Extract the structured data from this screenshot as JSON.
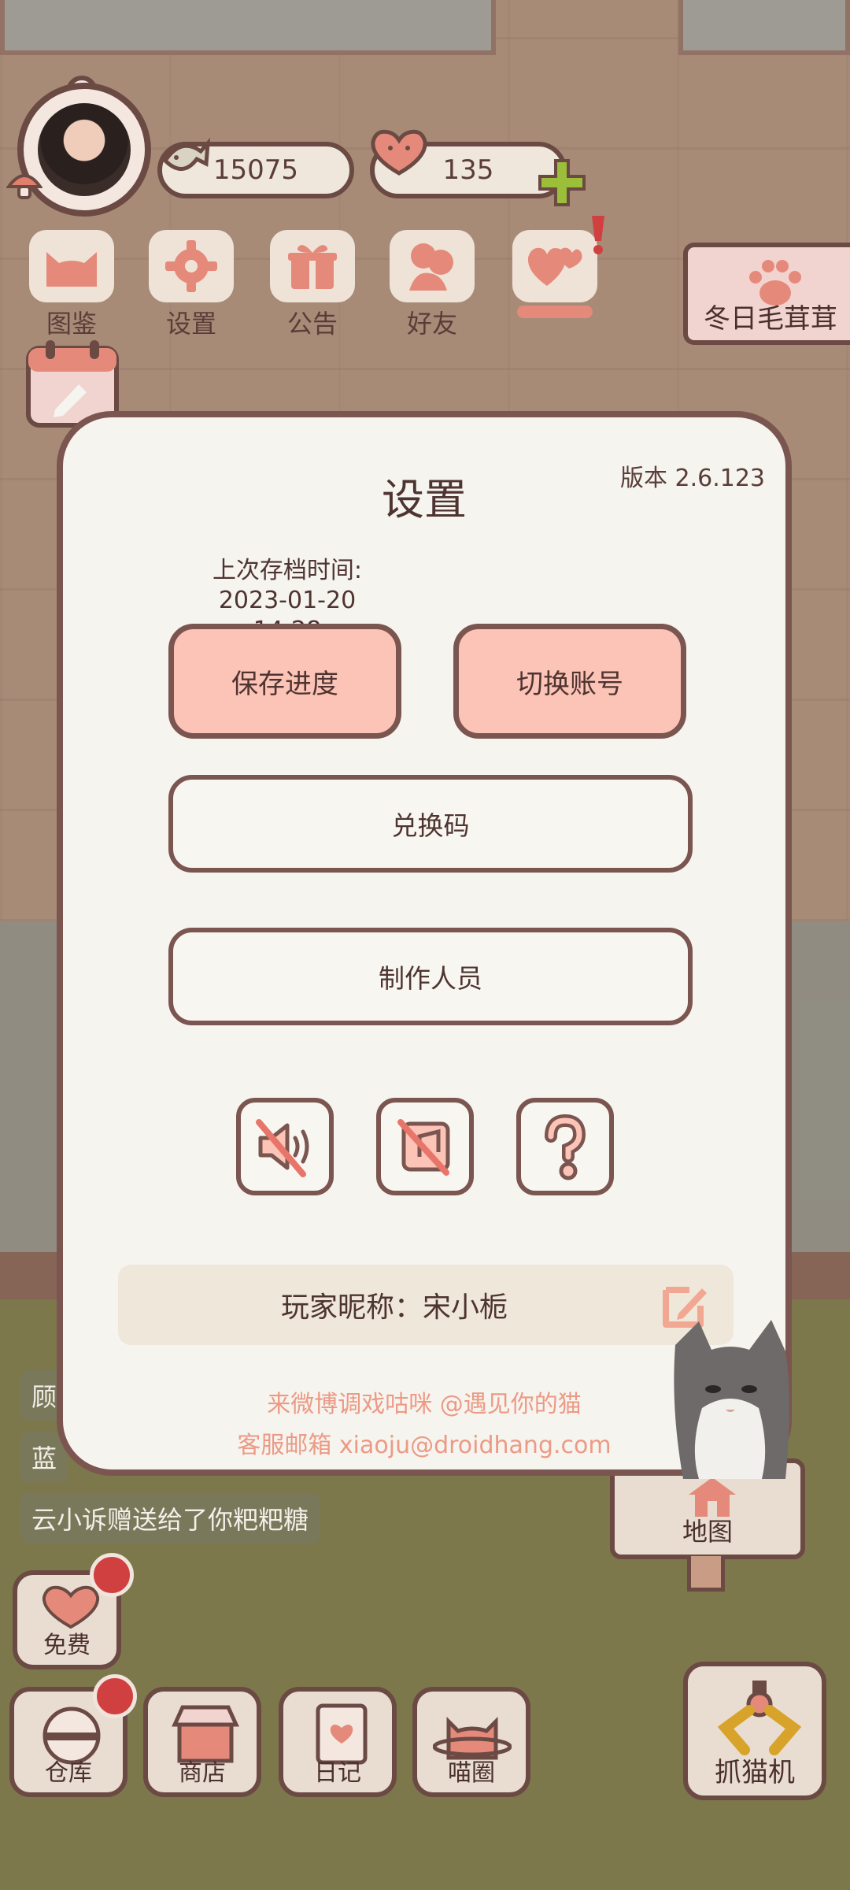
{
  "hud": {
    "fish_count": "15075",
    "heart_count": "135"
  },
  "top_menu": [
    {
      "label": "图鉴"
    },
    {
      "label": "设置"
    },
    {
      "label": "公告"
    },
    {
      "label": "好友"
    }
  ],
  "event_banner": {
    "label": "冬日毛茸茸"
  },
  "chat": [
    "顾",
    "蓝",
    "云小诉赠送给了你粑粑糖"
  ],
  "bottom_bar": {
    "free": "免费",
    "warehouse": "仓库",
    "shop": "商店",
    "diary": "日记",
    "meow_circle": "喵圈",
    "map": "地图",
    "claw_machine": "抓猫机"
  },
  "settings": {
    "title": "设置",
    "version": "版本 2.6.123",
    "save_time_label": "上次存档时间:",
    "save_time_value": "2023-01-20 14:28",
    "save_progress": "保存进度",
    "switch_account": "切换账号",
    "redeem_code": "兑换码",
    "credits": "制作人员",
    "nickname": "玩家昵称：宋小栀",
    "weibo_line": "来微博调戏咕咪 @遇见你的猫",
    "email_line": "客服邮箱 xiaoju@droidhang.com"
  },
  "colors": {
    "accent_pink": "#fcc3b7",
    "border_brown": "#7b5550",
    "link_salmon": "#ec9a85",
    "alert_red": "#d04040"
  }
}
